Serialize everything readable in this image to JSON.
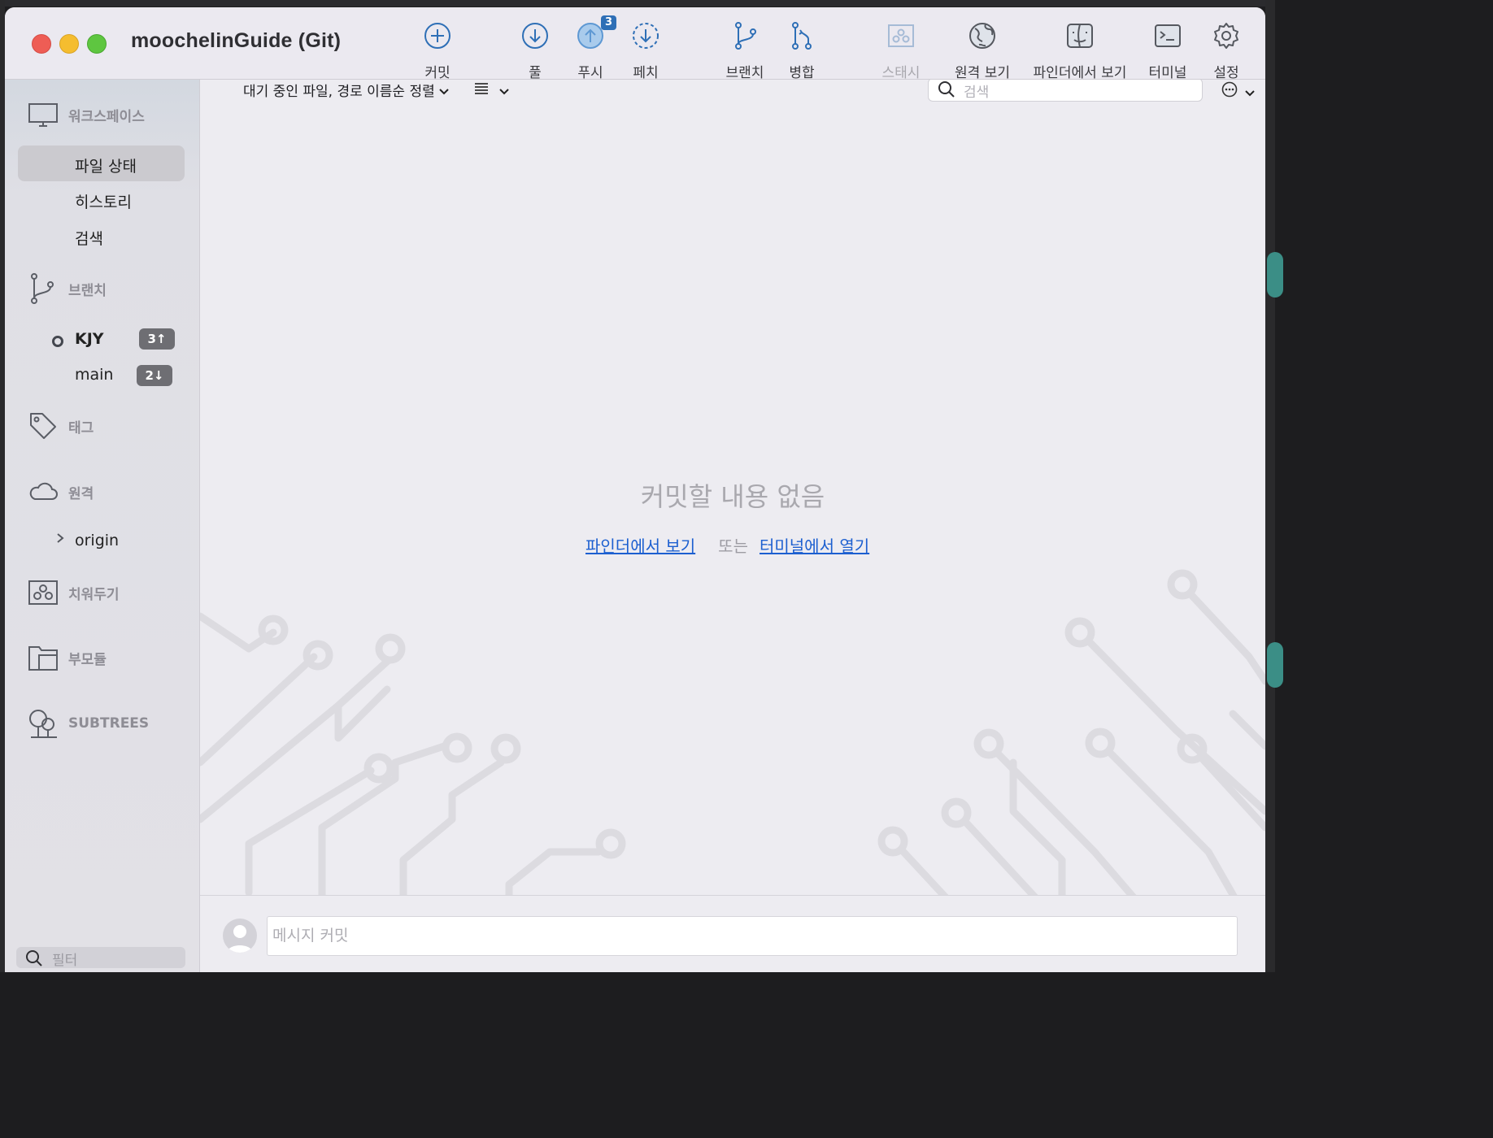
{
  "window": {
    "title": "moochelinGuide (Git)"
  },
  "toolbar": {
    "commit": "커밋",
    "pull": "풀",
    "push": "푸시",
    "push_badge": "3",
    "fetch": "페치",
    "branch": "브랜치",
    "merge": "병합",
    "stash": "스태시",
    "remote_view": "원격 보기",
    "finder_view": "파인더에서 보기",
    "terminal": "터미널",
    "settings": "설정"
  },
  "sidebar": {
    "workspace": {
      "title": "워크스페이스",
      "items": [
        "파일 상태",
        "히스토리",
        "검색"
      ],
      "selected": "파일 상태"
    },
    "branches": {
      "title": "브랜치",
      "items": [
        {
          "name": "KJY",
          "badge": "3↑",
          "current": true
        },
        {
          "name": "main",
          "badge": "2↓",
          "current": false
        }
      ]
    },
    "tags": {
      "title": "태그"
    },
    "remotes": {
      "title": "원격",
      "items": [
        "origin"
      ]
    },
    "stashes": {
      "title": "치워두기"
    },
    "submodules": {
      "title": "부모듈"
    },
    "subtrees": {
      "title": "SUBTREES"
    },
    "filter_placeholder": "필터"
  },
  "main": {
    "sort_label": "대기 중인 파일, 경로 이름순 정렬",
    "search_placeholder": "검색",
    "empty_title": "커밋할 내용 없음",
    "finder_link": "파인더에서 보기",
    "or_text": "또는",
    "terminal_link": "터미널에서 열기"
  },
  "commit": {
    "placeholder": "메시지 커밋"
  },
  "colors": {
    "accent": "#1c5fd0",
    "icon_blue": "#2e6fb6",
    "sidebar_bg": "#e2e1e6",
    "main_bg": "#edecf1"
  }
}
